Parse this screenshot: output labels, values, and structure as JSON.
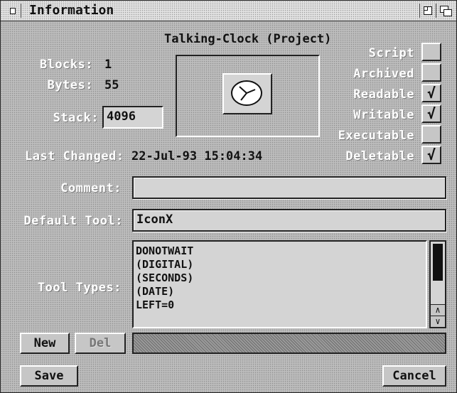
{
  "window": {
    "title": "Information"
  },
  "icon_title": "Talking-Clock (Project)",
  "blocks": {
    "label": "Blocks:",
    "value": "1"
  },
  "bytes": {
    "label": "Bytes:",
    "value": "55"
  },
  "stack": {
    "label": "Stack:",
    "value": "4096"
  },
  "last_changed": {
    "label": "Last Changed:",
    "value": "22-Jul-93 15:04:34"
  },
  "protection": [
    {
      "label": "Script",
      "checked": false
    },
    {
      "label": "Archived",
      "checked": false
    },
    {
      "label": "Readable",
      "checked": true
    },
    {
      "label": "Writable",
      "checked": true
    },
    {
      "label": "Executable",
      "checked": false
    },
    {
      "label": "Deletable",
      "checked": true
    }
  ],
  "check_glyph": "√",
  "comment": {
    "label": "Comment:",
    "value": ""
  },
  "default_tool": {
    "label": "Default Tool:",
    "value": "IconX"
  },
  "tool_types": {
    "label": "Tool Types:",
    "items": [
      "DONOTWAIT",
      "(DIGITAL)",
      "(SECONDS)",
      "(DATE)",
      "LEFT=0"
    ]
  },
  "buttons": {
    "new": "New",
    "del": "Del",
    "save": "Save",
    "cancel": "Cancel"
  },
  "scroll_up": "∧",
  "scroll_down": "∨"
}
